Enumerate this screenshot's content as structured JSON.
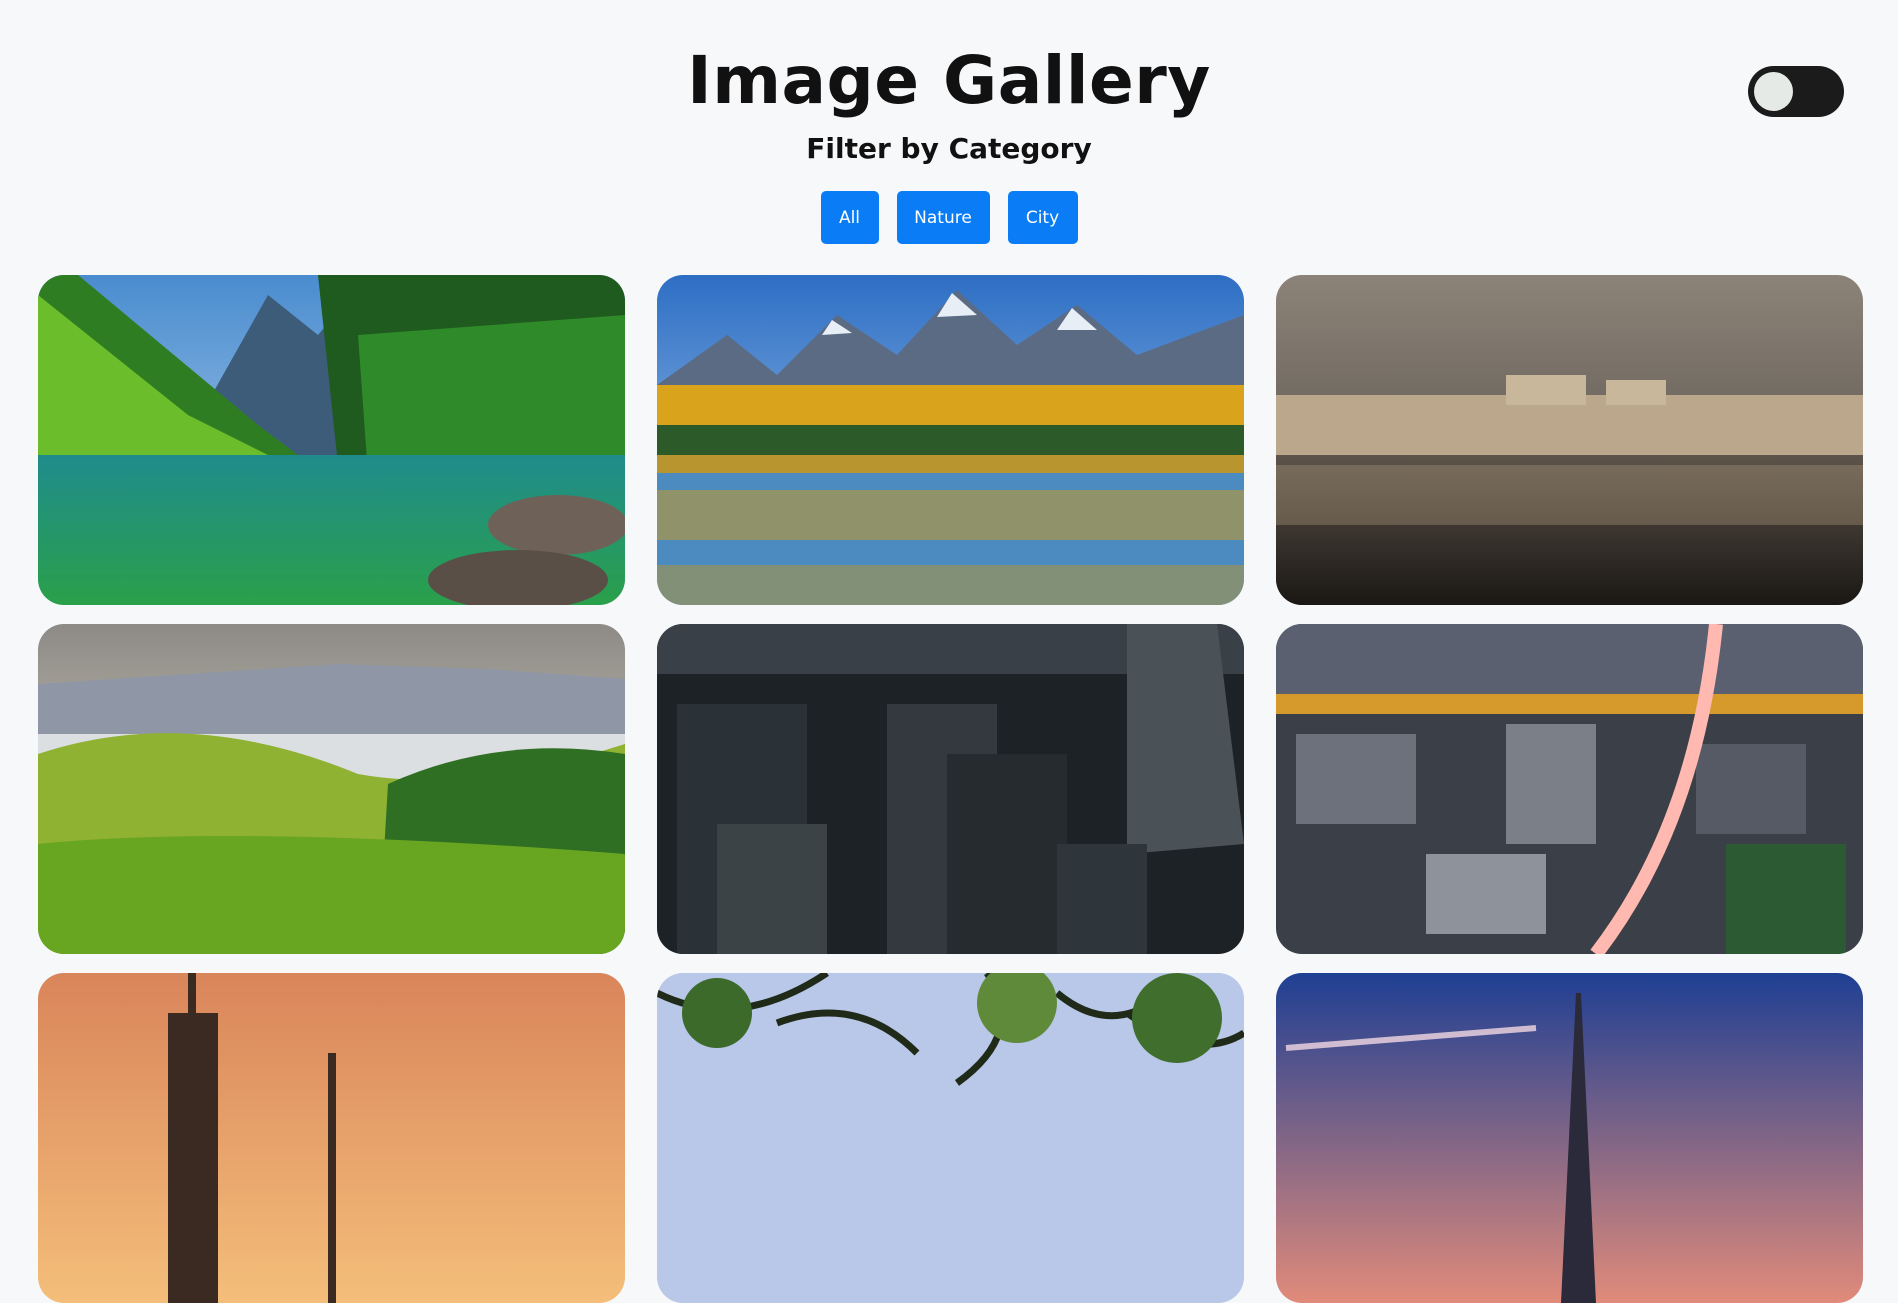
{
  "header": {
    "title": "Image Gallery",
    "filter_heading": "Filter by Category"
  },
  "filters": [
    {
      "label": "All"
    },
    {
      "label": "Nature"
    },
    {
      "label": "City"
    }
  ],
  "theme_toggle": {
    "state": "off"
  },
  "gallery": {
    "images": [
      {
        "category": "Nature",
        "subject": "lake with green mountains"
      },
      {
        "category": "Nature",
        "subject": "autumn trees reflected under mountains"
      },
      {
        "category": "City",
        "subject": "waterfront city at night"
      },
      {
        "category": "Nature",
        "subject": "green hills with misty valley"
      },
      {
        "category": "City",
        "subject": "aerial city skyscrapers at night"
      },
      {
        "category": "City",
        "subject": "aerial city with highway at night"
      },
      {
        "category": "City",
        "subject": "skyscraper at sunset"
      },
      {
        "category": "Nature",
        "subject": "tree canopy"
      },
      {
        "category": "City",
        "subject": "eiffel tower at dusk"
      }
    ]
  },
  "colors": {
    "accent": "#0a7cf5",
    "background": "#f7f8fa",
    "toggle": "#1b1b1b"
  }
}
